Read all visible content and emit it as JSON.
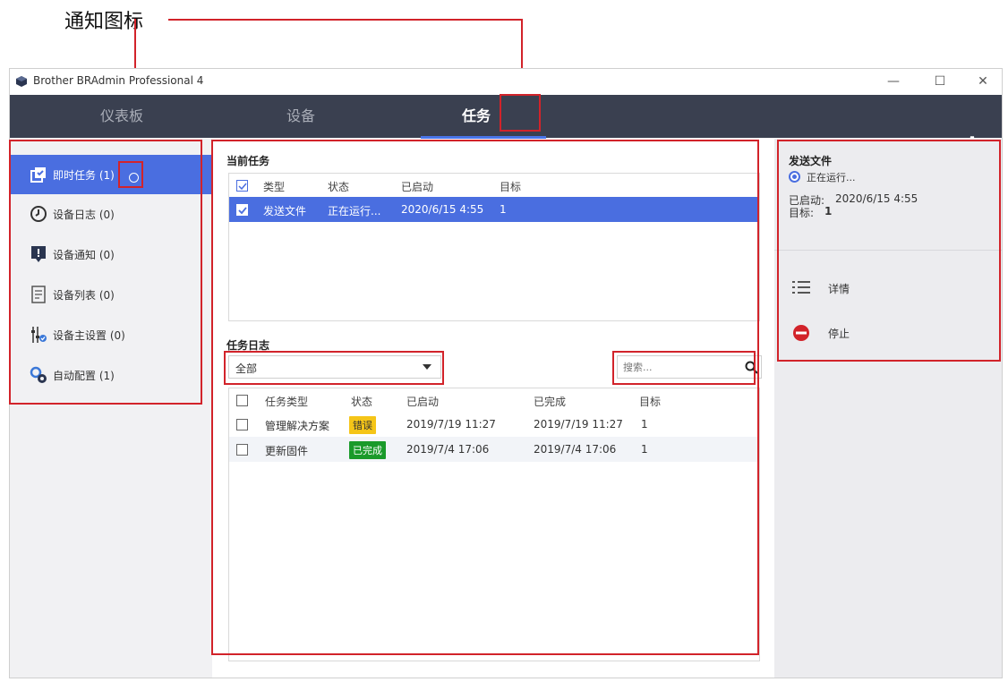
{
  "annotation": {
    "label": "通知图标"
  },
  "window": {
    "title": "Brother BRAdmin Professional 4",
    "controls": {
      "minimize": "—",
      "maximize": "☐",
      "close": "✕"
    }
  },
  "nav": {
    "tabs": [
      {
        "label": "仪表板",
        "active": false
      },
      {
        "label": "设备",
        "active": false
      },
      {
        "label": "任务",
        "active": true
      }
    ],
    "settings_icon": "gear-icon",
    "accent_color": "#4a74e8"
  },
  "sidebar": {
    "items": [
      {
        "label": "即时任务 (1)",
        "icon": "task-icon",
        "active": true
      },
      {
        "label": "设备日志 (0)",
        "icon": "clock-icon",
        "active": false
      },
      {
        "label": "设备通知 (0)",
        "icon": "alert-icon",
        "active": false
      },
      {
        "label": "设备列表 (0)",
        "icon": "document-icon",
        "active": false
      },
      {
        "label": "设备主设置 (0)",
        "icon": "sliders-icon",
        "active": false
      },
      {
        "label": "自动配置 (1)",
        "icon": "gears-icon",
        "active": false
      }
    ]
  },
  "current_tasks": {
    "title": "当前任务",
    "columns": [
      "类型",
      "状态",
      "已启动",
      "目标"
    ],
    "rows": [
      {
        "type": "发送文件",
        "status": "正在运行...",
        "started": "2020/6/15 4:55",
        "target": "1",
        "selected": true
      }
    ]
  },
  "task_log": {
    "title": "任务日志",
    "filter": {
      "selected": "全部"
    },
    "search": {
      "placeholder": "搜索..."
    },
    "columns": [
      "任务类型",
      "状态",
      "已启动",
      "已完成",
      "目标"
    ],
    "rows": [
      {
        "type": "管理解决方案",
        "status": "错误",
        "status_color": "#f5c518",
        "started": "2019/7/19 11:27",
        "finished": "2019/7/19 11:27",
        "target": "1"
      },
      {
        "type": "更新固件",
        "status": "已完成",
        "status_color": "#1a9a2a",
        "started": "2019/7/4 17:06",
        "finished": "2019/7/4 17:06",
        "target": "1"
      }
    ]
  },
  "detail_panel": {
    "title": "发送文件",
    "status": "正在运行...",
    "started_label": "已启动:",
    "started_value": "2020/6/15 4:55",
    "target_label": "目标:",
    "target_value": "1",
    "actions": [
      {
        "label": "详情",
        "icon": "list-icon"
      },
      {
        "label": "停止",
        "icon": "stop-icon"
      }
    ]
  }
}
